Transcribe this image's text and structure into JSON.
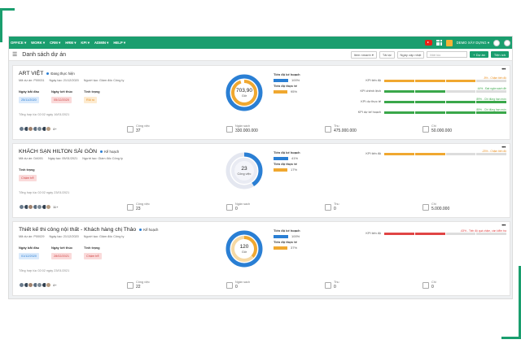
{
  "nav": {
    "items": [
      "OFFICE ▾",
      "WORK ▾",
      "CRM ▾",
      "HRM ▾",
      "KPI ▾",
      "ADMIN ▾",
      "HELP ▾"
    ],
    "company": "DEMO XÂY DỰNG ▾"
  },
  "toolbar": {
    "title": "Danh sách dự án",
    "item_menu": "Item nmanh ▾",
    "reload": "Tải lại",
    "sort": "Ngày cập nhật",
    "search_placeholder": "Mới lúc",
    "add": "+ Dự án",
    "more": "Tiện ích"
  },
  "colors": {
    "accent": "#1a9e6e",
    "blue": "#2a7fd4",
    "orange": "#f0a830",
    "red": "#e04545",
    "green": "#3aa74a"
  },
  "projects": [
    {
      "name": "ART VIỆT",
      "status": "Đang thực hiện",
      "code": "Mã dự án: P00031",
      "created": "Ngày tạo: 21/12/2020",
      "creator": "Người tạo: Giám đốc Công ty",
      "start_label": "Ngày bắt đầu",
      "start": "25/11/2020",
      "end_label": "Ngày kết thúc",
      "end": "05/12/2020",
      "state_label": "Tình trạng",
      "state": "Rủi ro",
      "updated": "Tổng hợp lúc 02:02 ngày 16/01/2021",
      "members_more": "4+",
      "donut_value": "703,90",
      "donut_unit": "Giờ",
      "plan_label": "Tiến độ kế hoạch",
      "plan": "100%",
      "plan_val": 100,
      "actual_label": "Tiến độ thực tế",
      "actual": "95%",
      "actual_val": 95,
      "stats": [
        {
          "label": "Công việc",
          "value": "37"
        },
        {
          "label": "Ngân sách",
          "value": "330.000.000"
        },
        {
          "label": "Thu",
          "value": "475.000.000"
        },
        {
          "label": "Chi",
          "value": "50.000.000"
        }
      ],
      "kpis": [
        {
          "label": "KPI tiến độ",
          "note": "-5% - Chậm tiến độ",
          "note_color": "#e88c1c",
          "fill": "orange"
        },
        {
          "label": "KPI chênh lệch",
          "note": "44% - Đạt ngân sách đề",
          "note_color": "#3aa74a",
          "fill": "green"
        },
        {
          "label": "KPI dự thực tế",
          "note": "89% - Chi đúng hạn mức",
          "note_color": "#3aa74a",
          "fill": "green"
        },
        {
          "label": "KPI dự kế hoạch",
          "note": "85% - Chi đúng hạn mức",
          "note_color": "#3aa74a",
          "fill": "green"
        }
      ]
    },
    {
      "name": "KHÁCH SẠN HILTON SÀI GÒN",
      "status": "Kế hoạch",
      "code": "Mã dự án: DA001",
      "created": "Ngày tạo: 05/01/2021",
      "creator": "Người tạo: Giám đốc Công ty",
      "state_label": "Tình trạng",
      "state": "Chậm trễ",
      "updated": "Tổng hợp lúc 02:02 ngày 23/01/2021",
      "members_more": "11+",
      "donut_value": "23",
      "donut_unit": "Công việc",
      "plan_label": "Tiến độ kế hoạch",
      "plan": "41%",
      "plan_val": 41,
      "actual_label": "Tiến độ thực tế",
      "actual": "17%",
      "actual_val": 17,
      "stats": [
        {
          "label": "Công việc",
          "value": "23"
        },
        {
          "label": "Ngân sách",
          "value": "0"
        },
        {
          "label": "Thu",
          "value": "0"
        },
        {
          "label": "Chi",
          "value": "5.000.000"
        }
      ],
      "kpis": [
        {
          "label": "KPI tiến độ",
          "note": "-23% - Chậm tiến độ",
          "note_color": "#e88c1c",
          "fill": "orange"
        }
      ]
    },
    {
      "name": "Thiết kế thi công nội thất - Khách hàng chị Thảo",
      "status": "Kế hoạch",
      "code": "Mã dự án: P00029",
      "created": "Ngày tạo: 21/12/2020",
      "creator": "Người tạo: Giám đốc Công ty",
      "start_label": "Ngày bắt đầu",
      "start": "01/12/2020",
      "end_label": "Ngày kết thúc",
      "end": "28/02/2021",
      "state_label": "Tình trạng",
      "state": "Chậm trễ",
      "updated": "Tổng hợp lúc 02:02 ngày 23/01/2021",
      "members_more": "4+",
      "donut_value": "120",
      "donut_unit": "Giờ",
      "plan_label": "Tiến độ kế hoạch",
      "plan": "100%",
      "plan_val": 100,
      "actual_label": "Tiến độ thực tế",
      "actual": "37%",
      "actual_val": 37,
      "stats": [
        {
          "label": "Công việc",
          "value": "22"
        },
        {
          "label": "Ngân sách",
          "value": "0"
        },
        {
          "label": "Thu",
          "value": "0"
        },
        {
          "label": "Chi",
          "value": "0"
        }
      ],
      "kpis": [
        {
          "label": "KPI tiến độ",
          "note": "-63% - Tiến độ quá chậm, cần kiểm tra",
          "note_color": "#e04545",
          "fill": "red"
        }
      ]
    }
  ]
}
